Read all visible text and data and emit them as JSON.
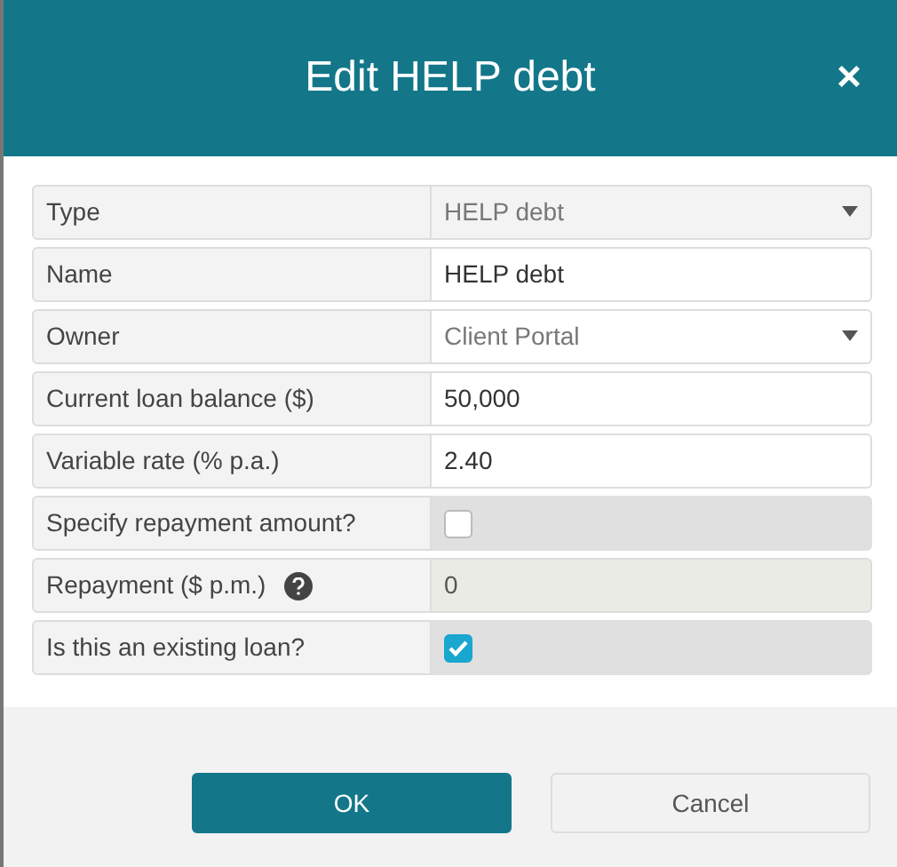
{
  "dialog": {
    "title": "Edit HELP debt",
    "close": "×"
  },
  "fields": [
    {
      "label": "Type",
      "kind": "select",
      "value": "HELP debt",
      "disabled": true
    },
    {
      "label": "Name",
      "kind": "input",
      "value": "HELP debt",
      "disabled": false
    },
    {
      "label": "Owner",
      "kind": "select",
      "value": "Client Portal",
      "disabled": false
    },
    {
      "label": "Current loan balance ($)",
      "kind": "input",
      "value": "50,000",
      "disabled": false
    },
    {
      "label": "Variable rate (% p.a.)",
      "kind": "input",
      "value": "2.40",
      "disabled": false
    },
    {
      "label": "Specify repayment amount?",
      "kind": "checkbox",
      "checked": false
    },
    {
      "label": "Repayment ($ p.m.)",
      "kind": "input",
      "value": "0",
      "disabled": true,
      "help": true
    },
    {
      "label": "Is this an existing loan?",
      "kind": "checkbox",
      "checked": true
    }
  ],
  "buttons": [
    {
      "label": "OK",
      "kind": "primary"
    },
    {
      "label": "Cancel",
      "kind": "secondary"
    }
  ]
}
